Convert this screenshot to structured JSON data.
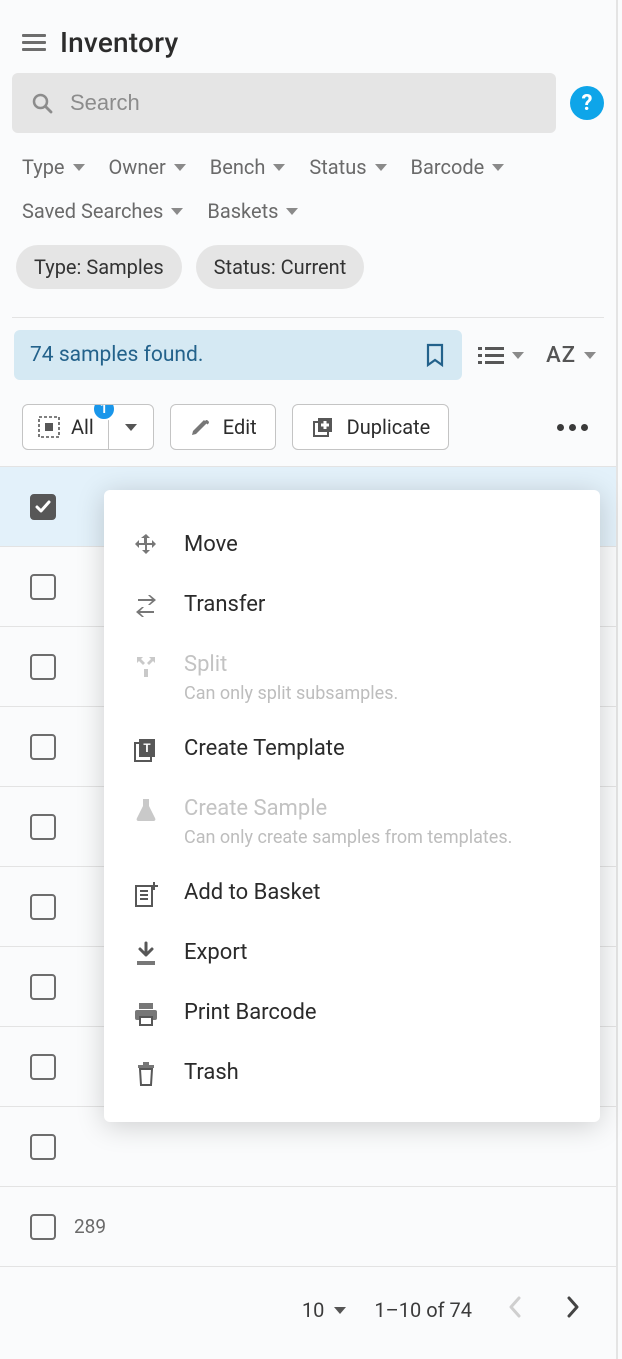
{
  "header": {
    "title": "Inventory",
    "help_glyph": "?"
  },
  "search": {
    "placeholder": "Search"
  },
  "filters": [
    "Type",
    "Owner",
    "Bench",
    "Status",
    "Barcode"
  ],
  "filters2": [
    "Saved Searches",
    "Baskets"
  ],
  "chips": [
    "Type: Samples",
    "Status: Current"
  ],
  "results": {
    "found_text": "74 samples found.",
    "sort_label": "AZ"
  },
  "toolbar": {
    "select_all_label": "All",
    "selection_count": "1",
    "edit_label": "Edit",
    "duplicate_label": "Duplicate"
  },
  "rows": {
    "count": 10,
    "selected_index": 0,
    "peek_text": "289"
  },
  "menu": [
    {
      "label": "Move"
    },
    {
      "label": "Transfer"
    },
    {
      "label": "Split",
      "sub": "Can only split subsamples.",
      "disabled": true
    },
    {
      "label": "Create Template"
    },
    {
      "label": "Create Sample",
      "sub": "Can only create samples from templates.",
      "disabled": true
    },
    {
      "label": "Add to Basket"
    },
    {
      "label": "Export"
    },
    {
      "label": "Print Barcode"
    },
    {
      "label": "Trash"
    }
  ],
  "pagination": {
    "per_page": "10",
    "range_text": "1–10 of 74"
  }
}
